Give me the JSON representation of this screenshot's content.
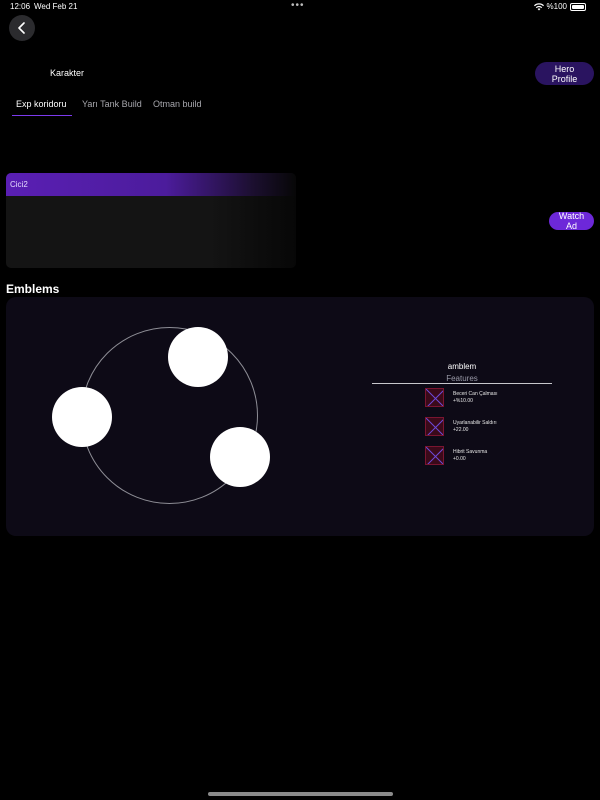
{
  "status_bar": {
    "time": "12:06",
    "date": "Wed Feb 21",
    "battery": "%100"
  },
  "header": {
    "title": "Karakter",
    "hero_profile_label": "Hero Profile"
  },
  "tabs": [
    {
      "label": "Exp koridoru",
      "active": true
    },
    {
      "label": "Yarı Tank Build",
      "active": false
    },
    {
      "label": "Otman build",
      "active": false
    }
  ],
  "build_card": {
    "name": "Cici2",
    "watch_ad_label": "Watch Ad"
  },
  "emblems": {
    "section_title": "Emblems",
    "emblem_name": "amblem",
    "features_label": "Features",
    "features": [
      {
        "name": "Beceri Can Çalması",
        "value": "+%10.00"
      },
      {
        "name": "Uyarlanabilir Saldırı",
        "value": "+22.00"
      },
      {
        "name": "Hibrit Savunma",
        "value": "+0.00"
      }
    ]
  },
  "colors": {
    "accent": "#6d28d9",
    "hero_button_bg": "#2a1460",
    "panel_bg": "#0d0a16",
    "card_bg": "#141414"
  },
  "icons": {
    "back": "chevron-left-icon",
    "wifi": "wifi-icon",
    "battery": "battery-icon",
    "feature_placeholder": "missing-image-icon"
  }
}
